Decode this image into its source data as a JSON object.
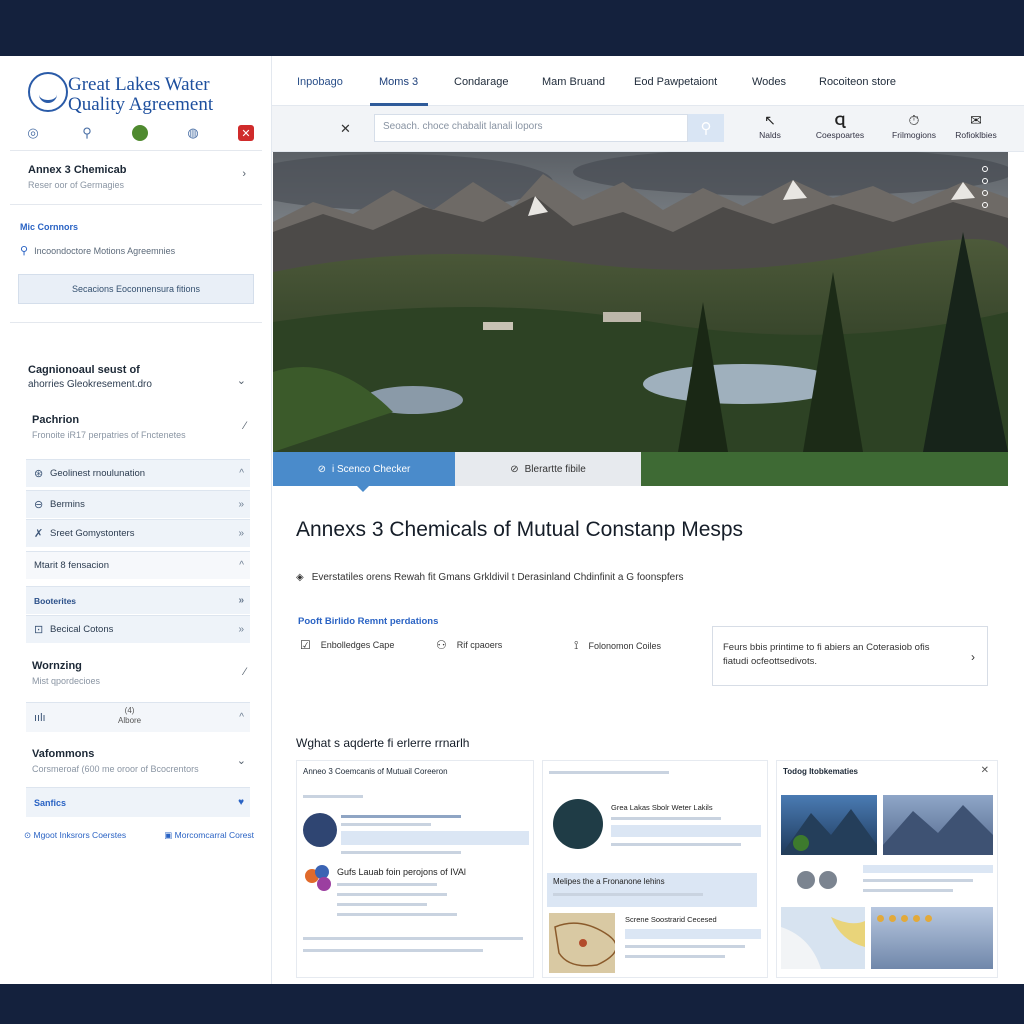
{
  "brand": {
    "line1": "Great Lakes Water",
    "line2": "Quality Agreement",
    "icons": [
      "globe-icon",
      "tools-icon",
      "leaf-icon",
      "water-drop-icon",
      "alert-icon"
    ]
  },
  "sidebar": {
    "annex": {
      "title": "Annex 3 Chemicab",
      "subtitle": "Reser oor of Germagies"
    },
    "mic": {
      "label": "Mic Cornnors",
      "search_text": "Incoondoctore Motions Agreemnies"
    },
    "section_button": "Secacions  Eoconnensura fitions",
    "group": {
      "line1": "Cagnionoaul seust of",
      "line2": "ahorries Gleokresement.dro"
    },
    "pachrion": {
      "title": "Pachrion",
      "subtitle": "Fronoite iR17 perpatries of Fnctenetes"
    },
    "items": [
      {
        "label": "Geolinest rnoulunation",
        "icon": "drop-icon",
        "arrow": "^"
      },
      {
        "label": "Bermins",
        "icon": "search-icon",
        "arrow": "»"
      },
      {
        "label": "Sreet Gomystonters",
        "icon": "person-icon",
        "arrow": "»"
      },
      {
        "label": "Mtarit 8 fensacion",
        "icon": "",
        "arrow": "^"
      },
      {
        "label": "Booterites",
        "icon": "",
        "arrow": "»"
      },
      {
        "label": "Becical Cotons",
        "icon": "grid-icon",
        "arrow": "»"
      }
    ],
    "wornzing": {
      "title": "Wornzing",
      "subtitle": "Mist qpordecioes"
    },
    "albore": {
      "label": "Albore",
      "icon_text": "(4)"
    },
    "vafommons": {
      "title": "Vafommons",
      "subtitle": "Corsmeroaf (600 me oroor of Bcocrentors"
    },
    "sanfics": "Sanfics",
    "footer": [
      "Mgoot Inksrors Coerstes",
      "Morcomcarral Corest"
    ]
  },
  "topnav": {
    "tabs": [
      "Inpobago",
      "Moms 3",
      "Condarage",
      "Mam Bruand",
      "Eod Pawpetaiont",
      "Wodes",
      "Rocoiteon store"
    ],
    "active_index": 1
  },
  "toolbar": {
    "search_placeholder": "Seoach. choce chabalit lanali lopors",
    "tools": [
      {
        "label": "Nalds",
        "icon": "arrow-icon"
      },
      {
        "label": "Coespoartes",
        "icon": "search-icon"
      },
      {
        "label": "Frilmogions",
        "icon": "timer-icon"
      },
      {
        "label": "Rofioklbies",
        "icon": "mail-icon"
      }
    ]
  },
  "hero": {
    "tab_active": "i Scenco Checker",
    "tab_second": "Blerartte fibile"
  },
  "content": {
    "title": "Annexs 3 Chemicals of Mutual Constanp Mesps",
    "description": "Everstatiles orens Rewah fit Gmans Grkldivil t Derasinland Chdinfinit a G foonspfers",
    "section_link": "Pooft Birlido Remnt perdations",
    "options": [
      {
        "label": "Enbolledges Cape",
        "icon": "checkbox-icon"
      },
      {
        "label": "Rif cpaoers",
        "icon": "people-icon"
      },
      {
        "label": "Folonomon Coiles",
        "icon": "hook-icon"
      }
    ],
    "callout": {
      "line1": "Feurs bbis printime to fi abiers an  Coterasiob ofis",
      "line2": "fiatudi ocfeottsedivots."
    },
    "gallery_title": "Wghat s aqderte fi erlerre rrnarlh"
  },
  "gallery": [
    {
      "title": "Anneo 3 Coemcanis of Mutuail Coreeron",
      "item_title": "Gufs Lauab foin perojons of IVAl"
    },
    {
      "title": "",
      "item_title": "Grea Lakas Sbolr Weter Lakils",
      "row": "Melipes the a Fronanone lehins",
      "row2": "Screne Soostrarid Cecesed"
    },
    {
      "title": "Todog Itobkematies"
    }
  ]
}
